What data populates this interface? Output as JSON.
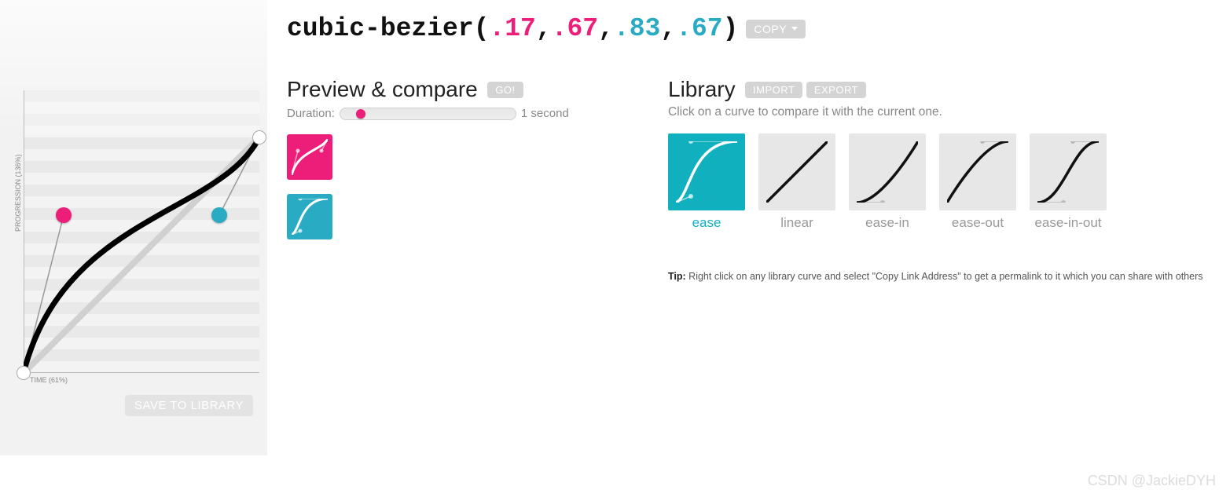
{
  "formula": {
    "prefix": "cubic-bezier(",
    "p1x": ".17",
    "p1y": ".67",
    "p2x": ".83",
    "p2y": ".67",
    "sep": ",",
    "suffix": ")",
    "copy_label": "COPY"
  },
  "editor": {
    "y_axis_label": "PROGRESSION (136%)",
    "x_axis_label": "TIME (61%)",
    "save_label": "SAVE TO LIBRARY"
  },
  "preview": {
    "heading": "Preview & compare",
    "go_label": "GO!",
    "duration_label": "Duration:",
    "duration_value": "1 second"
  },
  "library": {
    "heading": "Library",
    "import_label": "IMPORT",
    "export_label": "EXPORT",
    "helper": "Click on a curve to compare it with the current one.",
    "items": [
      {
        "label": "ease"
      },
      {
        "label": "linear"
      },
      {
        "label": "ease-in"
      },
      {
        "label": "ease-out"
      },
      {
        "label": "ease-in-out"
      }
    ],
    "tip_label": "Tip:",
    "tip_text": " Right click on any library curve and select \"Copy Link Address\" to get a permalink to it which you can share with others"
  },
  "watermark": "CSDN @JackieDYH"
}
